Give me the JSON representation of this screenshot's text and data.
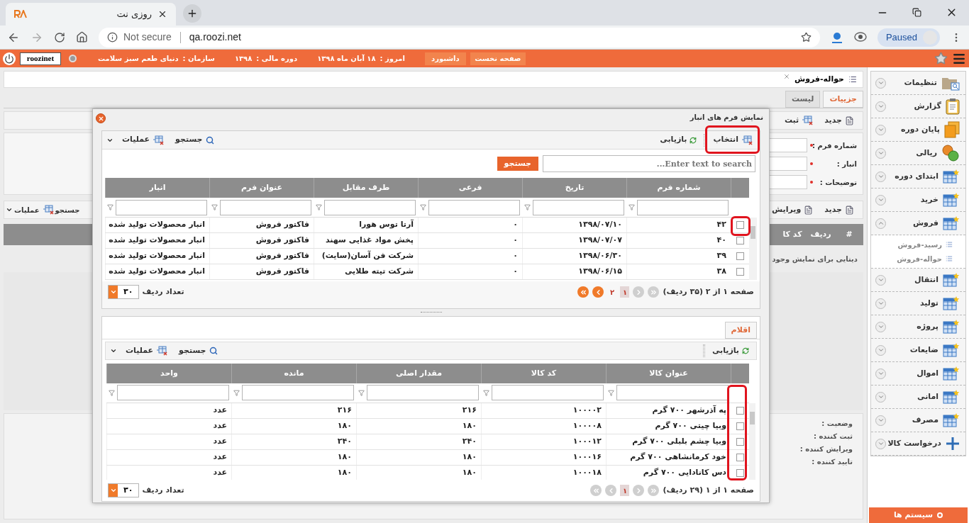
{
  "browser": {
    "tab_title": "روزی نت",
    "security": "Not secure",
    "url": "qa.roozi.net",
    "profile": "Paused"
  },
  "topbar": {
    "user": "roozinet",
    "org_label": "سازمان :",
    "org": "دنیای طعم سبز سلامت",
    "fy_label": "دوره مالی :",
    "fy": "۱۳۹۸",
    "today_label": "امروز :",
    "today": "۱۸ آبان ماه ۱۳۹۸",
    "buttons": [
      "صفحه نخست",
      "داشبورد"
    ]
  },
  "page": {
    "title": "حواله-فروش",
    "tabs": [
      {
        "label": "جزییات",
        "selected": true
      },
      {
        "label": "لیست",
        "selected": false
      }
    ],
    "toolbar": [
      "جدید",
      "ثبت"
    ],
    "fields": [
      {
        "label": "شماره فرم :",
        "required": true
      },
      {
        "label": "انبار :",
        "required": true
      },
      {
        "label": "توضیحات :",
        "required": true
      }
    ],
    "toolbar2_right": [
      "جدید",
      "ویرایش"
    ],
    "toolbar2_left": [
      "جستجو",
      "عملیات"
    ],
    "table_columns": [
      "#",
      "ردیف",
      "کد کا"
    ],
    "empty_text": "دیتایی برای نمایش وجود",
    "footer_labels": [
      "وضعیت :",
      "ثبت کننده :",
      "ویرایش کننده :",
      "تایید کننده :"
    ]
  },
  "sidebar": {
    "items": [
      {
        "label": "تنظیمات",
        "kind": "folder",
        "expanded": false
      },
      {
        "label": "گزارش",
        "kind": "clipboard",
        "expanded": false
      },
      {
        "label": "پایان دوره",
        "kind": "files",
        "expanded": false
      },
      {
        "label": "ریالی",
        "kind": "money",
        "expanded": false
      },
      {
        "label": "ابتدای دوره",
        "kind": "grid",
        "expanded": false
      },
      {
        "label": "خرید",
        "kind": "grid",
        "expanded": false
      },
      {
        "label": "فروش",
        "kind": "grid",
        "expanded": true,
        "children": [
          {
            "label": "رسید-فروش"
          },
          {
            "label": "حواله-فروش"
          }
        ]
      },
      {
        "label": "انتقال",
        "kind": "grid",
        "expanded": false
      },
      {
        "label": "تولید",
        "kind": "grid",
        "expanded": false
      },
      {
        "label": "پروژه",
        "kind": "grid",
        "expanded": false
      },
      {
        "label": "ضایعات",
        "kind": "grid",
        "expanded": false
      },
      {
        "label": "اموال",
        "kind": "grid",
        "expanded": false
      },
      {
        "label": "امانی",
        "kind": "grid",
        "expanded": false
      },
      {
        "label": "مصرف",
        "kind": "grid",
        "expanded": false
      },
      {
        "label": "درخواست کالا",
        "kind": "plus",
        "expanded": false
      }
    ],
    "footer": "سیستم ها"
  },
  "dialog": {
    "title": "نمایش فرم های انبار",
    "forms": {
      "select_button": "انتخاب",
      "refresh_button": "بازیابی",
      "search_button": "جستجو",
      "actions_button": "عملیات",
      "search_placeholder": "Enter text to search...",
      "search_go": "جستجو",
      "columns": [
        "شماره فرم",
        "تاریخ",
        "فرعی",
        "طرف مقابل",
        "عنوان فرم",
        "انبار"
      ],
      "rows": [
        {
          "checked": false,
          "cells": [
            "۴۲",
            "۱۳۹۸/۰۷/۱۰",
            "۰",
            "آرتا توس هورا",
            "فاکتور فروش",
            "انبار محصولات تولید شده"
          ]
        },
        {
          "checked": false,
          "cells": [
            "۴۰",
            "۱۳۹۸/۰۷/۰۷",
            "۰",
            "پخش مواد غذایی سهند",
            "فاکتور فروش",
            "انبار محصولات تولید شده"
          ]
        },
        {
          "checked": false,
          "cells": [
            "۳۹",
            "۱۳۹۸/۰۶/۳۰",
            "۰",
            "شرکت فن آسان(سایت)",
            "فاکتور فروش",
            "انبار محصولات تولید شده"
          ]
        },
        {
          "checked": false,
          "cells": [
            "۳۸",
            "۱۳۹۸/۰۶/۱۵",
            "۰",
            "شرکت تیته طلایی",
            "فاکتور فروش",
            "انبار محصولات تولید شده"
          ]
        }
      ],
      "pager": "صفحه ۱ از ۲ (۳۵ ردیف)",
      "pages": [
        {
          "label": "۱",
          "selected": true
        },
        {
          "label": "۲",
          "selected": false
        }
      ],
      "page_size": "۳۰",
      "page_size_label": "تعداد ردیف"
    },
    "items": {
      "tab": {
        "label": "اقلام",
        "selected": true
      },
      "refresh_button": "بازیابی",
      "search_button": "جستجو",
      "actions_button": "عملیات",
      "columns": [
        "عنوان کالا",
        "کد کالا",
        "مقدار اصلی",
        "مانده",
        "واحد"
      ],
      "rows": [
        {
          "checked": false,
          "cells": [
            "په آذرشهر ۷۰۰ گرم",
            "۱۰۰۰۰۲",
            "۲۱۶",
            "۲۱۶",
            "عدد"
          ]
        },
        {
          "checked": false,
          "cells": [
            "وبیا چیتی ۷۰۰ گرم",
            "۱۰۰۰۰۸",
            "۱۸۰",
            "۱۸۰",
            "عدد"
          ]
        },
        {
          "checked": false,
          "cells": [
            "وبیا چشم بلبلی ۷۰۰ گرم",
            "۱۰۰۰۱۲",
            "۲۴۰",
            "۲۴۰",
            "عدد"
          ]
        },
        {
          "checked": false,
          "cells": [
            "خود کرمانشاهی ۷۰۰ گرم",
            "۱۰۰۰۱۶",
            "۱۸۰",
            "۱۸۰",
            "عدد"
          ]
        },
        {
          "checked": false,
          "cells": [
            "دس کانادایی ۷۰۰ گرم",
            "۱۰۰۰۱۸",
            "۱۸۰",
            "۱۸۰",
            "عدد"
          ]
        }
      ],
      "pager": "صفحه ۱ از ۱ (۲۹ ردیف)",
      "pages": [
        {
          "label": "۱",
          "selected": true
        }
      ],
      "page_size": "۳۰",
      "page_size_label": "تعداد ردیف"
    }
  }
}
